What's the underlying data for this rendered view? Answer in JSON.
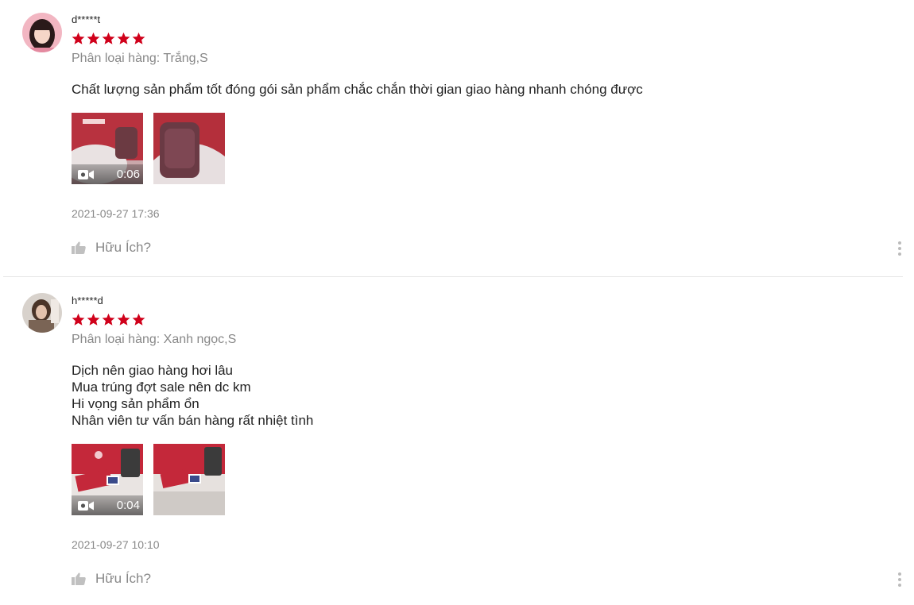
{
  "colors": {
    "star": "#d0011b",
    "muted": "#888888",
    "divider": "#e6e6e6"
  },
  "reviews": [
    {
      "username": "d*****t",
      "rating": 5,
      "variation": "Phân loại hàng: Trắng,S",
      "comment": "Chất lượng sản phẩm tốt đóng gói sản phẩm chắc chắn thời gian giao hàng nhanh chóng được",
      "media": [
        {
          "type": "video",
          "duration": "0:06"
        },
        {
          "type": "image"
        }
      ],
      "timestamp": "2021-09-27 17:36",
      "helpful_label": "Hữu Ích?"
    },
    {
      "username": "h*****d",
      "rating": 5,
      "variation": "Phân loại hàng: Xanh ngọc,S",
      "comment": "Dịch nên giao hàng hơi lâu\nMua trúng đợt sale nên dc km\nHi vọng sản phẩm ổn\nNhân viên tư vấn bán hàng rất nhiệt tình",
      "media": [
        {
          "type": "video",
          "duration": "0:04"
        },
        {
          "type": "image"
        }
      ],
      "timestamp": "2021-09-27 10:10",
      "helpful_label": "Hữu Ích?"
    }
  ]
}
